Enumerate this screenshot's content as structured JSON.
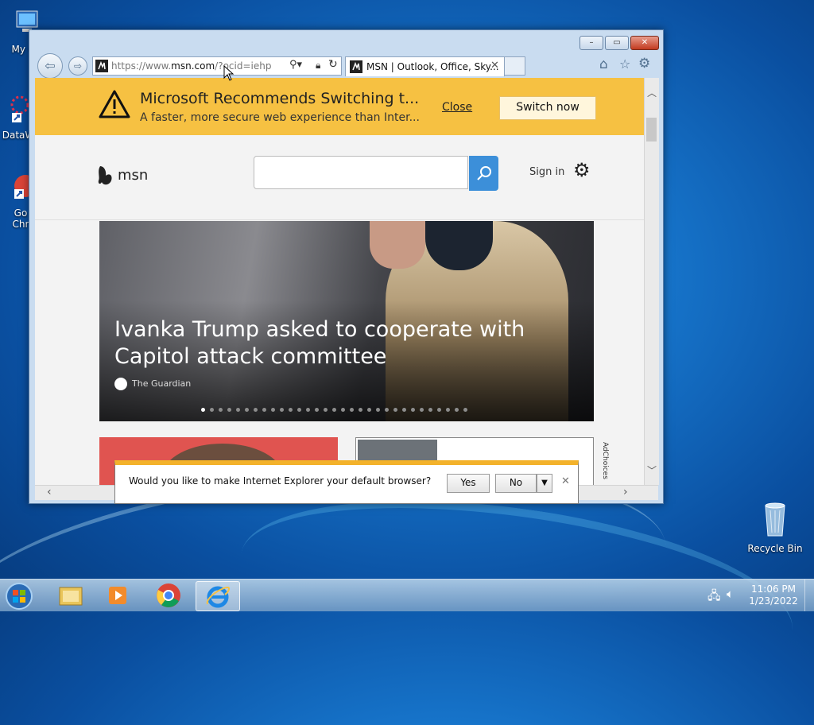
{
  "desktop": {
    "icons": [
      {
        "label": "My Co"
      },
      {
        "label": "DataW"
      },
      {
        "label": "Go"
      },
      {
        "label": "Chr"
      },
      {
        "label": "Recycle Bin"
      }
    ]
  },
  "browser": {
    "window_buttons": {
      "minimize": "–",
      "restore": "▭",
      "close": "✕"
    },
    "address": {
      "prefix": "https://www.",
      "domain": "msn.com",
      "path": "/?ocid=iehp"
    },
    "tab_title": "MSN | Outlook, Office, Sky...",
    "toolbar_icons": [
      "home-icon",
      "star-icon",
      "gear-icon"
    ]
  },
  "banner": {
    "title": "Microsoft Recommends Switching t...",
    "subtitle": "A faster, more secure web experience than Inter...",
    "close_label": "Close",
    "switch_label": "Switch now",
    "color": "#f6c142"
  },
  "msn": {
    "logo_text": "msn",
    "search_placeholder": "",
    "sign_in": "Sign in",
    "accent": "#3c8fd9"
  },
  "hero": {
    "headline": "Ivanka Trump asked to cooperate with Capitol attack committee",
    "source": "The Guardian",
    "slide_count": 31,
    "active_slide": 1
  },
  "ad_choices": "AdChoices",
  "notification": {
    "message": "Would you like to make Internet Explorer your default browser?",
    "yes_label": "Yes",
    "no_label": "No",
    "accent": "#f3b22b"
  },
  "taskbar": {
    "time": "11:06 PM",
    "date": "1/23/2022"
  }
}
